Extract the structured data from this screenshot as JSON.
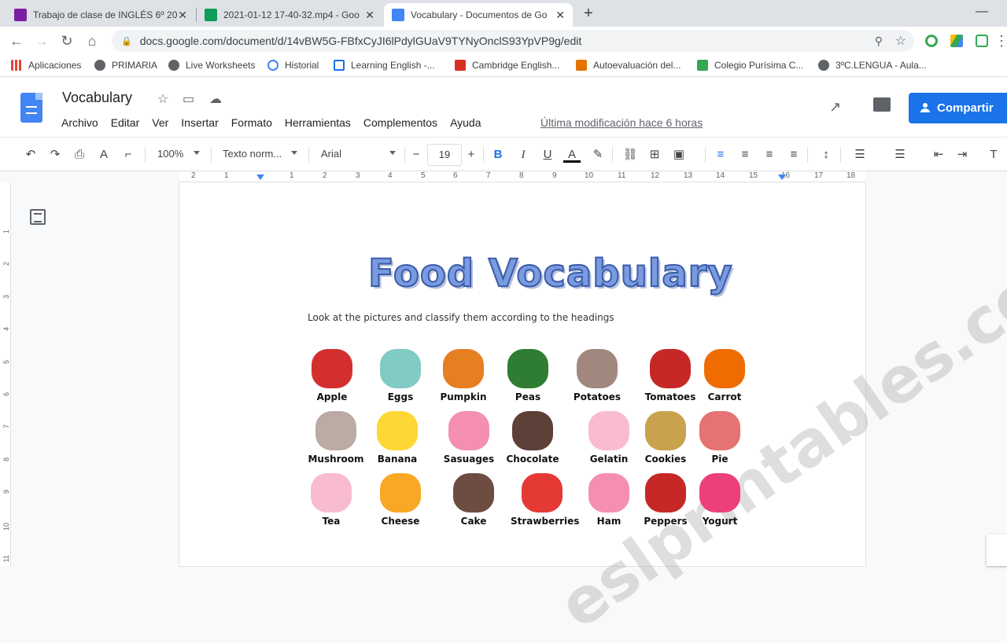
{
  "browser": {
    "tabs": [
      {
        "title": "Trabajo de clase de INGLÉS 6º 20",
        "favicon_color": "#7b1fa2"
      },
      {
        "title": "2021-01-12 17-40-32.mp4 - Goo",
        "favicon_color": "#0f9d58"
      },
      {
        "title": "Vocabulary - Documentos de Go",
        "favicon_color": "#4285f4"
      }
    ],
    "close_glyph": "✕",
    "newtab_glyph": "+",
    "url": "docs.google.com/document/d/14vBW5G-FBfxCyJI6lPdylGUaV9TYNyOnclS93YpVP9g/edit"
  },
  "bookmarks": [
    {
      "label": "Aplicaciones",
      "color": "#ea4335"
    },
    {
      "label": "PRIMARIA",
      "color": "#5f6368"
    },
    {
      "label": "Live Worksheets",
      "color": "#5f6368"
    },
    {
      "label": "Historial",
      "color": "#4285f4"
    },
    {
      "label": "Learning English -...",
      "color": "#1a73e8"
    },
    {
      "label": "Cambridge English...",
      "color": "#d93025"
    },
    {
      "label": "Autoevaluación del...",
      "color": "#e37400"
    },
    {
      "label": "Colegio Purísima C...",
      "color": "#34a853"
    },
    {
      "label": "3ºC.LENGUA - Aula...",
      "color": "#5f6368"
    }
  ],
  "doc": {
    "title": "Vocabulary",
    "menus": [
      "Archivo",
      "Editar",
      "Ver",
      "Insertar",
      "Formato",
      "Herramientas",
      "Complementos",
      "Ayuda"
    ],
    "last_modified": "Última modificación hace 6 horas",
    "share_label": "Compartir"
  },
  "format": {
    "zoom": "100%",
    "style": "Texto norm...",
    "font": "Arial",
    "size": "19"
  },
  "ruler": [
    "2",
    "1",
    "1",
    "2",
    "3",
    "4",
    "5",
    "6",
    "7",
    "8",
    "9",
    "10",
    "11",
    "12",
    "13",
    "14",
    "15",
    "16",
    "17",
    "18"
  ],
  "vruler": [
    "1",
    "2",
    "3",
    "4",
    "5",
    "6",
    "7",
    "8",
    "9",
    "10",
    "11"
  ],
  "content": {
    "heading": "Food Vocabulary",
    "instruction": "Look at the pictures and classify them according to the headings",
    "watermark": "eslprintables.com",
    "foods": [
      {
        "label": "Apple",
        "color": "#d32f2f"
      },
      {
        "label": "Eggs",
        "color": "#80cbc4"
      },
      {
        "label": "Pumpkin",
        "color": "#e67e22"
      },
      {
        "label": "Peas",
        "color": "#2e7d32"
      },
      {
        "label": "Potatoes",
        "color": "#a1887f"
      },
      {
        "label": "Tomatoes",
        "color": "#c62828"
      },
      {
        "label": "Carrot",
        "color": "#ef6c00"
      },
      {
        "label": "Mushroom",
        "color": "#bcaaa4"
      },
      {
        "label": "Banana",
        "color": "#fdd835"
      },
      {
        "label": "Sasuages",
        "color": "#f48fb1"
      },
      {
        "label": "Chocolate",
        "color": "#5d4037"
      },
      {
        "label": "Gelatin",
        "color": "#f8bbd0"
      },
      {
        "label": "Cookies",
        "color": "#c9a24d"
      },
      {
        "label": "Pie",
        "color": "#e57373"
      },
      {
        "label": "Tea",
        "color": "#f8bbd0"
      },
      {
        "label": "Cheese",
        "color": "#f9a825"
      },
      {
        "label": "Cake",
        "color": "#6d4c41"
      },
      {
        "label": "Strawberries",
        "color": "#e53935"
      },
      {
        "label": "Ham",
        "color": "#f48fb1"
      },
      {
        "label": "Peppers",
        "color": "#c62828"
      },
      {
        "label": "Yogurt",
        "color": "#ec407a"
      }
    ]
  }
}
